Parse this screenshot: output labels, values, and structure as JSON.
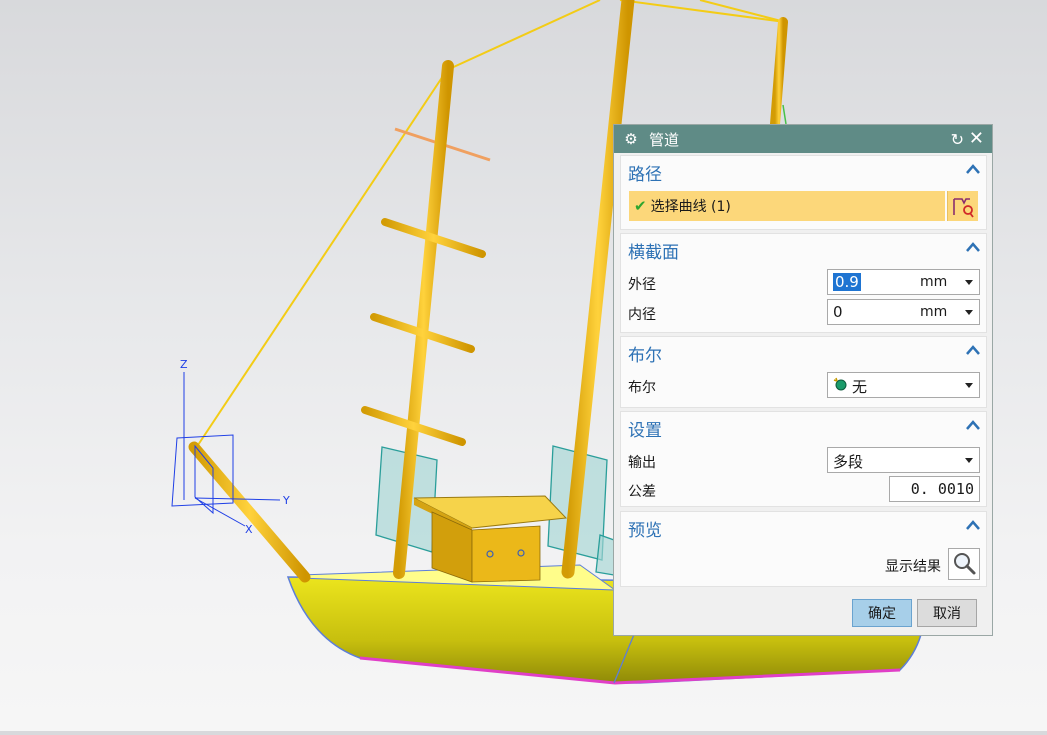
{
  "dialog": {
    "title": "管道",
    "icons": {
      "gear": "gear-icon",
      "reset": "reset-icon",
      "close": "close-icon"
    },
    "sections": {
      "path": {
        "title": "路径",
        "select_curve": "选择曲线 (1)"
      },
      "cross_section": {
        "title": "横截面",
        "outer_label": "外径",
        "outer_value": "0.9",
        "outer_unit": "mm",
        "inner_label": "内径",
        "inner_value": "0",
        "inner_unit": "mm"
      },
      "boolean": {
        "title": "布尔",
        "label": "布尔",
        "value": "无"
      },
      "settings": {
        "title": "设置",
        "output_label": "输出",
        "output_value": "多段",
        "tolerance_label": "公差",
        "tolerance_value": "0. 0010"
      },
      "preview": {
        "title": "预览",
        "show_result_label": "显示结果"
      }
    },
    "buttons": {
      "ok": "确定",
      "cancel": "取消"
    }
  },
  "triad": {
    "z": "Z",
    "y": "Y",
    "x": "X"
  },
  "colors": {
    "titlebar": "#5f8b86",
    "section_title": "#2e72b5",
    "selection_row": "#fcd77a",
    "model_yellow": "#f5c21b",
    "hull_yellow": "#c9c21a"
  }
}
